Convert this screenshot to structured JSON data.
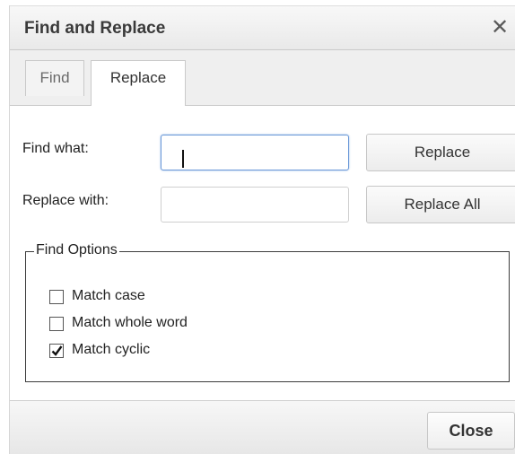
{
  "dialog": {
    "title": "Find and Replace",
    "close_glyph": "✕"
  },
  "tabs": [
    {
      "label": "Find",
      "active": false
    },
    {
      "label": "Replace",
      "active": true
    }
  ],
  "form": {
    "find_label": "Find what:",
    "find_value": "",
    "replace_label": "Replace with:",
    "replace_value": "",
    "replace_button": "Replace",
    "replace_all_button": "Replace All"
  },
  "options": {
    "legend": "Find Options",
    "items": [
      {
        "label": "Match case",
        "checked": false
      },
      {
        "label": "Match whole word",
        "checked": false
      },
      {
        "label": "Match cyclic",
        "checked": true
      }
    ]
  },
  "footer": {
    "close_button": "Close"
  },
  "icons": {
    "close": "close-icon",
    "check": "checkmark-icon"
  },
  "colors": {
    "focus_border": "#6a98d8"
  }
}
